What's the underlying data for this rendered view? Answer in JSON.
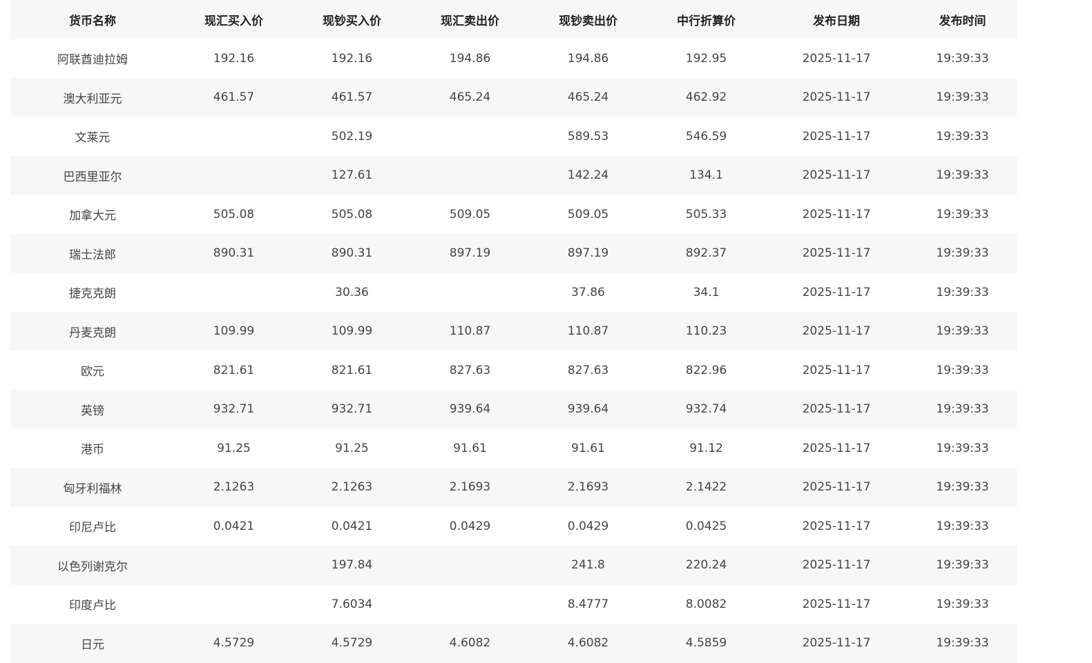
{
  "table": {
    "headers": [
      "货币名称",
      "现汇买入价",
      "现钞买入价",
      "现汇卖出价",
      "现钞卖出价",
      "中行折算价",
      "发布日期",
      "发布时间"
    ],
    "rows": [
      [
        "阿联酋迪拉姆",
        "192.16",
        "192.16",
        "194.86",
        "194.86",
        "192.95",
        "2025-11-17",
        "19:39:33"
      ],
      [
        "澳大利亚元",
        "461.57",
        "461.57",
        "465.24",
        "465.24",
        "462.92",
        "2025-11-17",
        "19:39:33"
      ],
      [
        "文莱元",
        "",
        "502.19",
        "",
        "589.53",
        "546.59",
        "2025-11-17",
        "19:39:33"
      ],
      [
        "巴西里亚尔",
        "",
        "127.61",
        "",
        "142.24",
        "134.1",
        "2025-11-17",
        "19:39:33"
      ],
      [
        "加拿大元",
        "505.08",
        "505.08",
        "509.05",
        "509.05",
        "505.33",
        "2025-11-17",
        "19:39:33"
      ],
      [
        "瑞士法郎",
        "890.31",
        "890.31",
        "897.19",
        "897.19",
        "892.37",
        "2025-11-17",
        "19:39:33"
      ],
      [
        "捷克克朗",
        "",
        "30.36",
        "",
        "37.86",
        "34.1",
        "2025-11-17",
        "19:39:33"
      ],
      [
        "丹麦克朗",
        "109.99",
        "109.99",
        "110.87",
        "110.87",
        "110.23",
        "2025-11-17",
        "19:39:33"
      ],
      [
        "欧元",
        "821.61",
        "821.61",
        "827.63",
        "827.63",
        "822.96",
        "2025-11-17",
        "19:39:33"
      ],
      [
        "英镑",
        "932.71",
        "932.71",
        "939.64",
        "939.64",
        "932.74",
        "2025-11-17",
        "19:39:33"
      ],
      [
        "港币",
        "91.25",
        "91.25",
        "91.61",
        "91.61",
        "91.12",
        "2025-11-17",
        "19:39:33"
      ],
      [
        "匈牙利福林",
        "2.1263",
        "2.1263",
        "2.1693",
        "2.1693",
        "2.1422",
        "2025-11-17",
        "19:39:33"
      ],
      [
        "印尼卢比",
        "0.0421",
        "0.0421",
        "0.0429",
        "0.0429",
        "0.0425",
        "2025-11-17",
        "19:39:33"
      ],
      [
        "以色列谢克尔",
        "",
        "197.84",
        "",
        "241.8",
        "220.24",
        "2025-11-17",
        "19:39:33"
      ],
      [
        "印度卢比",
        "",
        "7.6034",
        "",
        "8.4777",
        "8.0082",
        "2025-11-17",
        "19:39:33"
      ],
      [
        "日元",
        "4.5729",
        "4.5729",
        "4.6082",
        "4.6082",
        "4.5859",
        "2025-11-17",
        "19:39:33"
      ]
    ]
  },
  "colors": {
    "stripe": "#f7f7f7",
    "text": "#444444",
    "header_text": "#222222"
  }
}
